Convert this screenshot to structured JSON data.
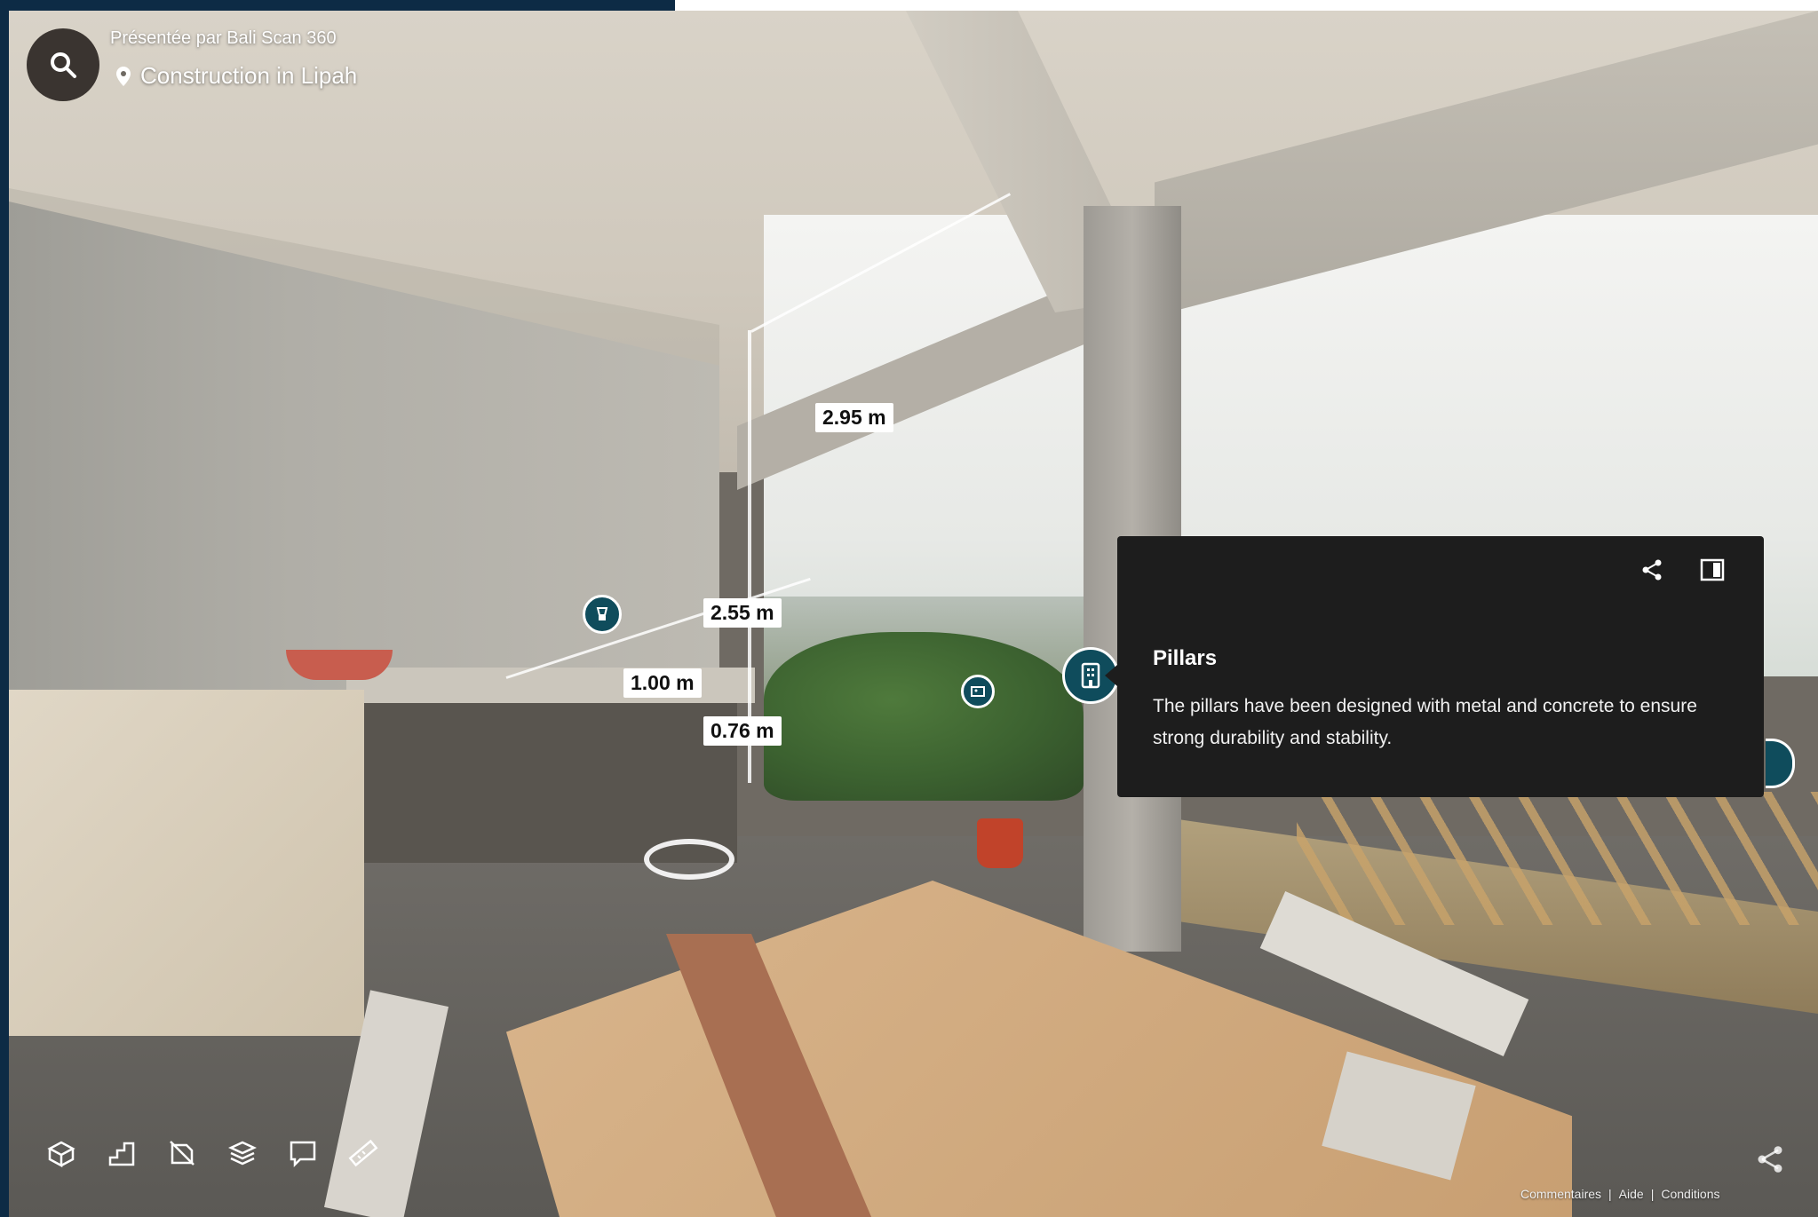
{
  "header": {
    "presented_by": "Présentée par Bali Scan 360",
    "location_name": "Construction in Lipah"
  },
  "measurements": {
    "height_total": "2.95 m",
    "height_partial": "2.55 m",
    "counter_width": "1.00 m",
    "counter_height": "0.76 m"
  },
  "info_card": {
    "title": "Pillars",
    "description": "The pillars have been designed with metal and concrete to ensure strong durability and stability."
  },
  "toolbar": {
    "items": [
      "dollhouse-view-icon",
      "floorplan-icon",
      "hide-tags-icon",
      "floor-selector-icon",
      "comments-icon",
      "measure-icon"
    ]
  },
  "footer": {
    "comments": "Commentaires",
    "help": "Aide",
    "terms": "Conditions"
  },
  "colors": {
    "pin": "#0f4c5c",
    "card_bg": "#1d1d1d",
    "frame": "#0d2b45"
  }
}
